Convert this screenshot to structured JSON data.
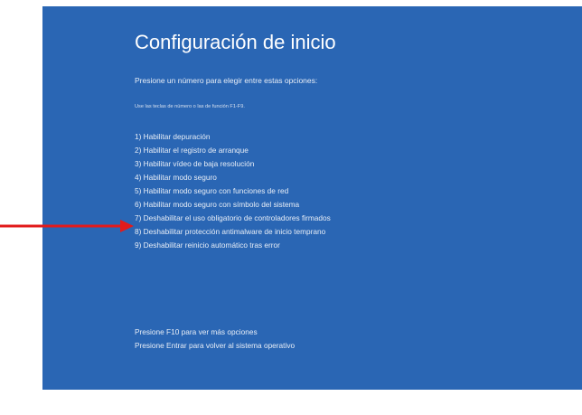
{
  "screen": {
    "title": "Configuración de inicio",
    "subtitle": "Presione un número para elegir entre estas opciones:",
    "hint": "Use las teclas de número o las de función F1-F9.",
    "background_color": "#2a66b4"
  },
  "options": [
    {
      "label": "1) Habilitar depuración"
    },
    {
      "label": "2) Habilitar el registro de arranque"
    },
    {
      "label": "3) Habilitar vídeo de baja resolución"
    },
    {
      "label": "4) Habilitar modo seguro"
    },
    {
      "label": "5) Habilitar modo seguro con funciones de red"
    },
    {
      "label": "6) Habilitar modo seguro con símbolo del sistema"
    },
    {
      "label": "7) Deshabilitar el uso obligatorio de controladores firmados"
    },
    {
      "label": "8) Deshabilitar protección antimalware de inicio temprano"
    },
    {
      "label": "9) Deshabilitar reinicio automático tras error"
    }
  ],
  "footer": {
    "more_options": "Presione F10 para ver más opciones",
    "return": "Presione Entrar para volver al sistema operativo"
  },
  "annotation": {
    "arrow_color": "#e21b1b",
    "points_to_option": 7
  }
}
